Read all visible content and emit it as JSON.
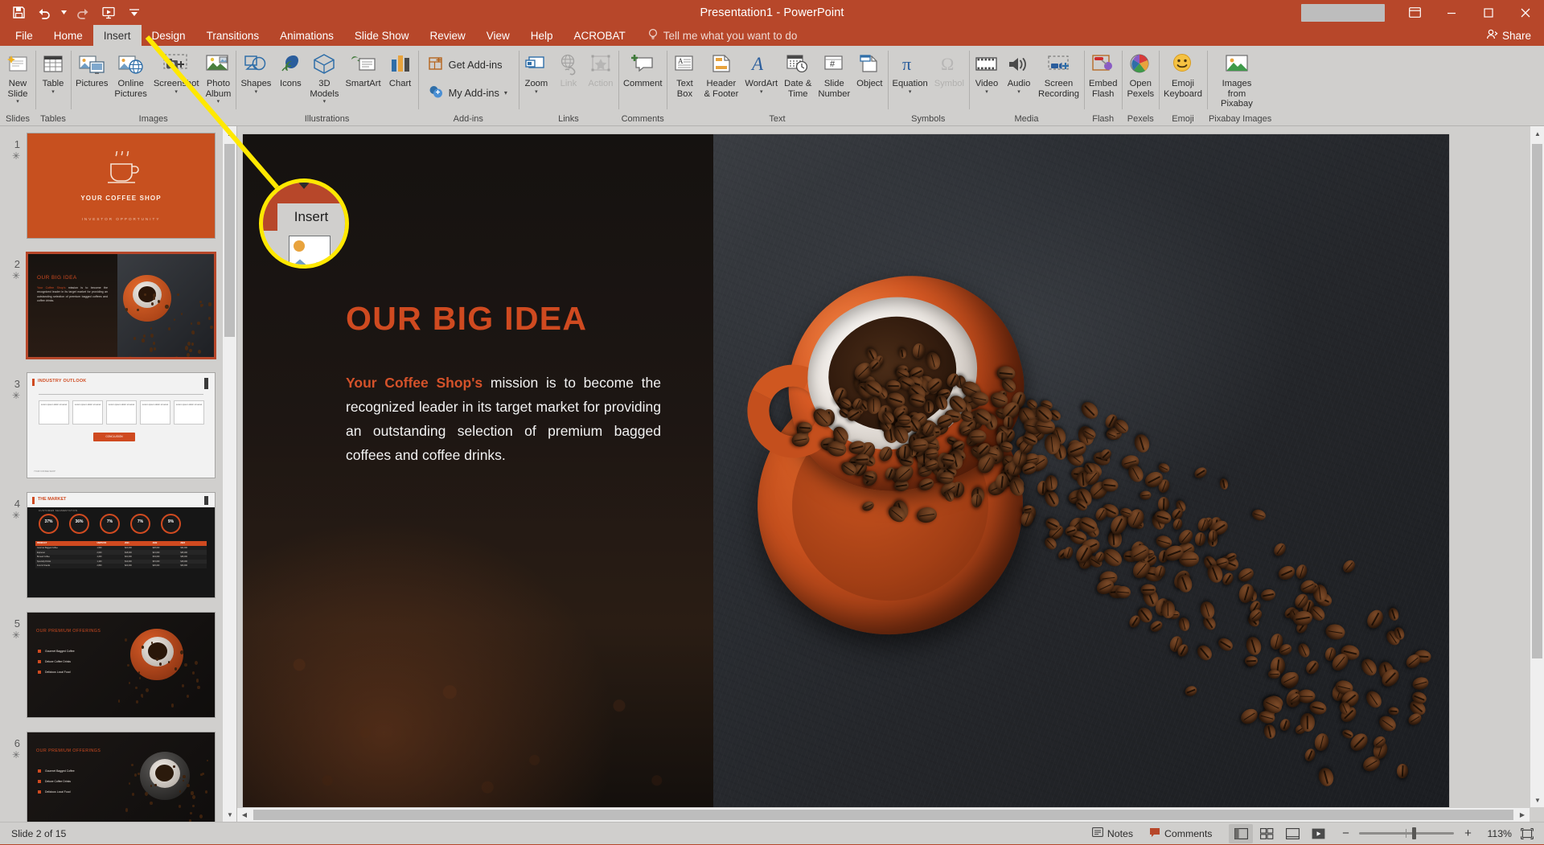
{
  "titlebar": {
    "title": "Presentation1  -  PowerPoint",
    "qat": [
      {
        "name": "save-icon",
        "label": "Save"
      },
      {
        "name": "undo-icon",
        "label": "Undo"
      },
      {
        "name": "redo-icon",
        "label": "Redo"
      },
      {
        "name": "start-presentation-icon",
        "label": "Start From Beginning"
      },
      {
        "name": "customize-qat-icon",
        "label": "Customize Quick Access Toolbar"
      }
    ],
    "window": [
      {
        "name": "ribbon-display-options-icon",
        "label": "Ribbon Display Options"
      },
      {
        "name": "minimize-icon",
        "label": "Minimize"
      },
      {
        "name": "restore-icon",
        "label": "Restore Down"
      },
      {
        "name": "close-icon",
        "label": "Close"
      }
    ]
  },
  "tabs": [
    {
      "label": "File",
      "active": false
    },
    {
      "label": "Home",
      "active": false
    },
    {
      "label": "Insert",
      "active": true
    },
    {
      "label": "Design",
      "active": false
    },
    {
      "label": "Transitions",
      "active": false
    },
    {
      "label": "Animations",
      "active": false
    },
    {
      "label": "Slide Show",
      "active": false
    },
    {
      "label": "Review",
      "active": false
    },
    {
      "label": "View",
      "active": false
    },
    {
      "label": "Help",
      "active": false
    },
    {
      "label": "ACROBAT",
      "active": false
    }
  ],
  "tellme": {
    "placeholder": "Tell me what you want to do"
  },
  "share": {
    "label": "Share"
  },
  "ribbon": {
    "groups": [
      {
        "label": "Slides",
        "buttons": [
          {
            "label": "New\nSlide",
            "icon": "new-slide-icon",
            "caret": true,
            "disabled": false
          }
        ]
      },
      {
        "label": "Tables",
        "buttons": [
          {
            "label": "Table",
            "icon": "table-icon",
            "caret": true,
            "disabled": false
          }
        ]
      },
      {
        "label": "Images",
        "buttons": [
          {
            "label": "Pictures",
            "icon": "pictures-icon",
            "caret": false,
            "disabled": false
          },
          {
            "label": "Online\nPictures",
            "icon": "online-pictures-icon",
            "caret": false,
            "disabled": false
          },
          {
            "label": "Screenshot",
            "icon": "screenshot-icon",
            "caret": true,
            "disabled": false
          },
          {
            "label": "Photo\nAlbum",
            "icon": "photo-album-icon",
            "caret": true,
            "disabled": false
          }
        ]
      },
      {
        "label": "Illustrations",
        "buttons": [
          {
            "label": "Shapes",
            "icon": "shapes-icon",
            "caret": true,
            "disabled": false
          },
          {
            "label": "Icons",
            "icon": "icons-icon",
            "caret": false,
            "disabled": false
          },
          {
            "label": "3D\nModels",
            "icon": "3d-models-icon",
            "caret": true,
            "disabled": false
          },
          {
            "label": "SmartArt",
            "icon": "smartart-icon",
            "caret": false,
            "disabled": false
          },
          {
            "label": "Chart",
            "icon": "chart-icon",
            "caret": false,
            "disabled": false
          }
        ]
      },
      {
        "label": "Add-ins",
        "small_buttons": [
          {
            "label": "Get Add-ins",
            "icon": "get-addins-icon",
            "caret": false
          },
          {
            "label": "My Add-ins",
            "icon": "my-addins-icon",
            "caret": true
          }
        ]
      },
      {
        "label": "Links",
        "buttons": [
          {
            "label": "Zoom",
            "icon": "zoom-icon",
            "caret": true,
            "disabled": false
          },
          {
            "label": "Link",
            "icon": "link-icon",
            "caret": false,
            "disabled": true
          },
          {
            "label": "Action",
            "icon": "action-icon",
            "caret": false,
            "disabled": true
          }
        ]
      },
      {
        "label": "Comments",
        "buttons": [
          {
            "label": "Comment",
            "icon": "comment-icon",
            "caret": false,
            "disabled": false
          }
        ]
      },
      {
        "label": "Text",
        "buttons": [
          {
            "label": "Text\nBox",
            "icon": "text-box-icon",
            "caret": false,
            "disabled": false
          },
          {
            "label": "Header\n& Footer",
            "icon": "header-footer-icon",
            "caret": false,
            "disabled": false
          },
          {
            "label": "WordArt",
            "icon": "wordart-icon",
            "caret": true,
            "disabled": false
          },
          {
            "label": "Date &\nTime",
            "icon": "date-time-icon",
            "caret": false,
            "disabled": false
          },
          {
            "label": "Slide\nNumber",
            "icon": "slide-number-icon",
            "caret": false,
            "disabled": false
          },
          {
            "label": "Object",
            "icon": "object-icon",
            "caret": false,
            "disabled": false
          }
        ]
      },
      {
        "label": "Symbols",
        "buttons": [
          {
            "label": "Equation",
            "icon": "equation-icon",
            "caret": true,
            "disabled": false
          },
          {
            "label": "Symbol",
            "icon": "symbol-icon",
            "caret": false,
            "disabled": true
          }
        ]
      },
      {
        "label": "Media",
        "buttons": [
          {
            "label": "Video",
            "icon": "video-icon",
            "caret": true,
            "disabled": false
          },
          {
            "label": "Audio",
            "icon": "audio-icon",
            "caret": true,
            "disabled": false
          },
          {
            "label": "Screen\nRecording",
            "icon": "screen-recording-icon",
            "caret": false,
            "disabled": false
          }
        ]
      },
      {
        "label": "Flash",
        "buttons": [
          {
            "label": "Embed\nFlash",
            "icon": "embed-flash-icon",
            "caret": false,
            "disabled": false
          }
        ]
      },
      {
        "label": "Pexels",
        "buttons": [
          {
            "label": "Open\nPexels",
            "icon": "open-pexels-icon",
            "caret": false,
            "disabled": false
          }
        ]
      },
      {
        "label": "Emoji",
        "buttons": [
          {
            "label": "Emoji\nKeyboard",
            "icon": "emoji-keyboard-icon",
            "caret": false,
            "disabled": false
          }
        ]
      },
      {
        "label": "Pixabay Images",
        "buttons": [
          {
            "label": "Images from\nPixabay",
            "icon": "images-from-pixabay-icon",
            "caret": false,
            "disabled": false
          }
        ]
      }
    ]
  },
  "thumbnails": [
    {
      "number": "1",
      "modified": "✳",
      "selected": false,
      "title": "YOUR COFFEE SHOP",
      "subtitle": "INVESTOR OPPORTUNITY",
      "kind": "cover"
    },
    {
      "number": "2",
      "modified": "✳",
      "selected": true,
      "title": "OUR BIG IDEA",
      "kind": "bigidea"
    },
    {
      "number": "3",
      "modified": "✳",
      "selected": false,
      "title": "INDUSTRY OUTLOOK",
      "kind": "outlook"
    },
    {
      "number": "4",
      "modified": "✳",
      "selected": false,
      "title": "THE MARKET",
      "kind": "market"
    },
    {
      "number": "5",
      "modified": "✳",
      "selected": false,
      "title": "OUR PREMIUM OFFERINGS",
      "kind": "offerings"
    },
    {
      "number": "6",
      "modified": "✳",
      "selected": false,
      "title": "OUR PREMIUM OFFERINGS",
      "kind": "offerings2"
    }
  ],
  "thumb_market": {
    "stats": [
      "37%",
      "36%",
      "7%",
      "7%",
      "9%"
    ],
    "table_headers": [
      "PRODUCT",
      "UNITS/YR",
      "2021",
      "2022",
      "2023"
    ],
    "table_rows": [
      [
        "Gourmet Bagged Coffee",
        "1,500",
        "$24,000",
        "$28,000",
        "$32,000"
      ],
      [
        "Espresso",
        "2,000",
        "$18,000",
        "$21,000",
        "$25,000"
      ],
      [
        "Brewed Coffee",
        "4,200",
        "$31,000",
        "$34,000",
        "$38,000"
      ],
      [
        "Specialty Drinks",
        "1,100",
        "$12,000",
        "$15,000",
        "$18,000"
      ],
      [
        "Food & Snacks",
        "2,800",
        "$22,000",
        "$26,000",
        "$30,000"
      ]
    ]
  },
  "thumb_offerings": {
    "items": [
      "Gourmet Bagged Coffee",
      "Deluxe Coffee Drinks",
      "Delicious Local Food"
    ]
  },
  "slide": {
    "title": "OUR BIG IDEA",
    "body_lead": "Your Coffee Shop's",
    "body_rest": " mission is to become the recognized leader in its target market for providing an outstanding selection of premium bagged coffees and coffee drinks."
  },
  "callout": {
    "tab_label": "Insert"
  },
  "statusbar": {
    "slide_indicator": "Slide 2 of 15",
    "notes_label": "Notes",
    "comments_label": "Comments",
    "views": [
      {
        "name": "normal-view-button",
        "label": "Normal",
        "active": true
      },
      {
        "name": "slide-sorter-view-button",
        "label": "Slide Sorter",
        "active": false
      },
      {
        "name": "reading-view-button",
        "label": "Reading View",
        "active": false
      },
      {
        "name": "slide-show-button",
        "label": "Slide Show",
        "active": false
      }
    ],
    "zoom_out": "−",
    "zoom_in": "+",
    "zoom_value": "113%",
    "fit_label": "Fit slide to current window"
  },
  "colors": {
    "brand": "#b7472a",
    "ribbon_bg": "#d0cfcd",
    "accent_orange": "#cf4a20",
    "callout_ring": "#ffe800"
  }
}
